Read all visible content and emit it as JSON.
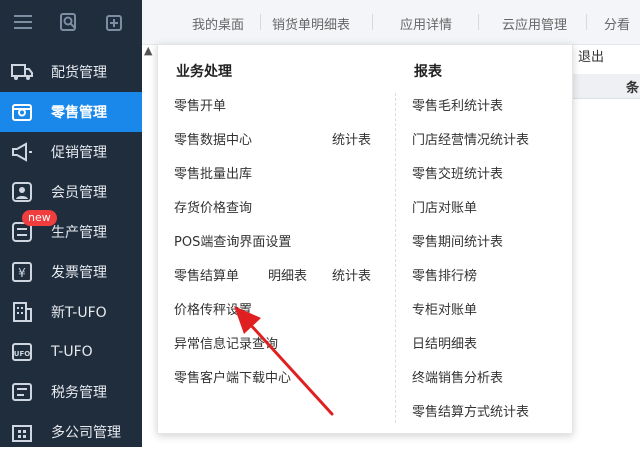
{
  "sidebar": {
    "items": [
      {
        "label": "配货管理",
        "icon": "truck-icon"
      },
      {
        "label": "零售管理",
        "icon": "retail-icon"
      },
      {
        "label": "促销管理",
        "icon": "megaphone-icon"
      },
      {
        "label": "会员管理",
        "icon": "member-icon"
      },
      {
        "label": "生产管理",
        "icon": "production-icon"
      },
      {
        "label": "发票管理",
        "icon": "invoice-icon"
      },
      {
        "label": "新T-UFO",
        "icon": "building-icon"
      },
      {
        "label": "T-UFO",
        "icon": "ufo-icon"
      },
      {
        "label": "税务管理",
        "icon": "tax-icon"
      },
      {
        "label": "多公司管理",
        "icon": "company-icon"
      }
    ],
    "new_badge": "new"
  },
  "tabs": [
    "我的桌面",
    "销货单明细表",
    "应用详情",
    "云应用管理",
    "分看"
  ],
  "right": {
    "logout": "退出",
    "col_header": "条"
  },
  "menu": {
    "left_title": "业务处理",
    "right_title": "报表",
    "left": {
      "retail_open": "零售开单",
      "retail_data_center": "零售数据中心",
      "stat_table_1": "统计表",
      "retail_batch_out": "零售批量出库",
      "stock_price_query": "存货价格查询",
      "pos_query_ui": "POS端查询界面设置",
      "retail_settle": "零售结算单",
      "detail_table": "明细表",
      "stat_table_2": "统计表",
      "price_scale_setting": "价格传秤设置",
      "exception_query": "异常信息记录查询",
      "client_download": "零售客户端下载中心"
    },
    "right": [
      "零售毛利统计表",
      "门店经营情况统计表",
      "零售交班统计表",
      "门店对账单",
      "零售期间统计表",
      "零售排行榜",
      "专柜对账单",
      "日结明细表",
      "终端销售分析表",
      "零售结算方式统计表"
    ]
  },
  "colors": {
    "sidebar_bg": "#1f2d3d",
    "active": "#1a87ea",
    "arrow": "#e02020",
    "badge": "#f03d3d"
  }
}
